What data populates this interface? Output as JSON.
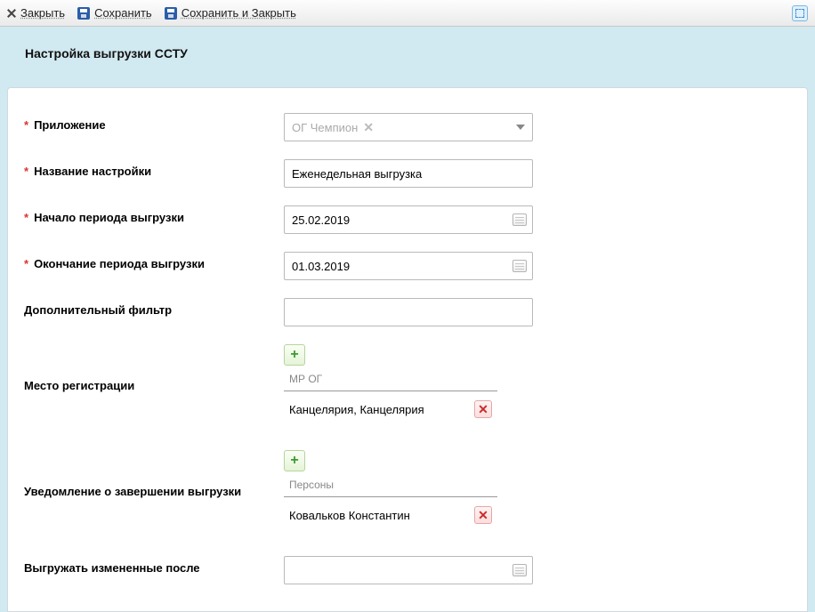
{
  "toolbar": {
    "close": "Закрыть",
    "save": "Сохранить",
    "save_close": "Сохранить и Закрыть"
  },
  "header": {
    "title": "Настройка выгрузки ССТУ"
  },
  "fields": {
    "app": {
      "label": "Приложение",
      "value": "ОГ Чемпион"
    },
    "name": {
      "label": "Название настройки",
      "value": "Еженедельная выгрузка"
    },
    "period_start": {
      "label": "Начало периода выгрузки",
      "value": "25.02.2019"
    },
    "period_end": {
      "label": "Окончание периода выгрузки",
      "value": "01.03.2019"
    },
    "filter": {
      "label": "Дополнительный фильтр",
      "value": ""
    },
    "reg_place": {
      "label": "Место регистрации",
      "sub_label": "МР ОГ",
      "items": [
        "Канцелярия, Канцелярия"
      ]
    },
    "notify": {
      "label": "Уведомление о завершении выгрузки",
      "sub_label": "Персоны",
      "items": [
        "Ковальков Константин"
      ]
    },
    "changed_after": {
      "label": "Выгружать измененные после",
      "value": ""
    }
  }
}
